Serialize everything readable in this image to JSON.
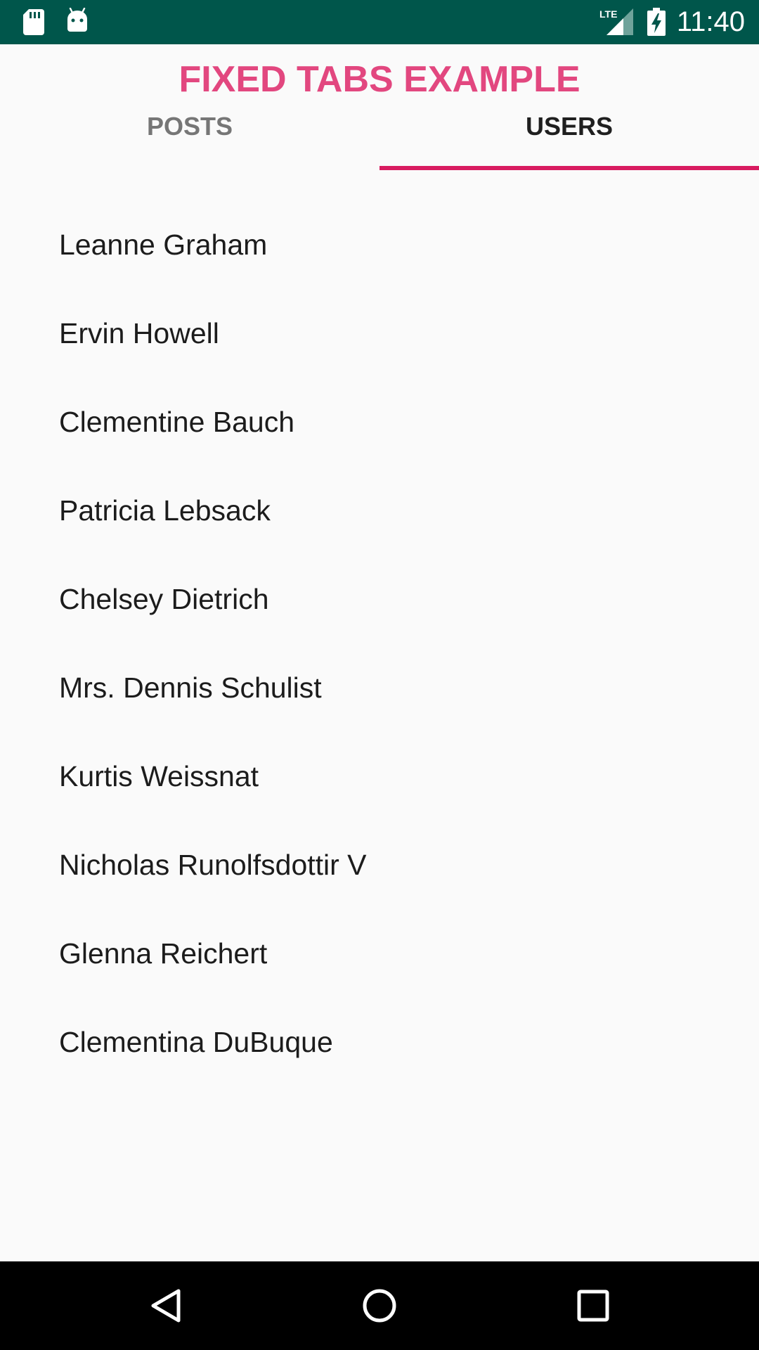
{
  "status_bar": {
    "time": "11:40",
    "network": "LTE",
    "icons": [
      "sd-card-icon",
      "android-icon",
      "lte-signal-icon",
      "battery-charging-icon"
    ]
  },
  "app": {
    "title": "FIXED TABS EXAMPLE",
    "accent_color": "#e2477f",
    "status_bar_color": "#00564b"
  },
  "tabs": [
    {
      "label": "POSTS",
      "selected": false
    },
    {
      "label": "USERS",
      "selected": true
    }
  ],
  "users": [
    "Leanne Graham",
    "Ervin Howell",
    "Clementine Bauch",
    "Patricia Lebsack",
    "Chelsey Dietrich",
    "Mrs. Dennis Schulist",
    "Kurtis Weissnat",
    "Nicholas Runolfsdottir V",
    "Glenna Reichert",
    "Clementina DuBuque"
  ],
  "nav_bar": {
    "icons": [
      "back-icon",
      "home-icon",
      "recents-icon"
    ]
  }
}
